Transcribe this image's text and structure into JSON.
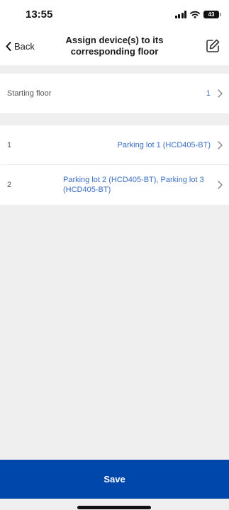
{
  "status_bar": {
    "time": "13:55",
    "battery": "43"
  },
  "nav": {
    "back_label": "Back",
    "title": "Assign device(s) to its corresponding floor",
    "icons": {
      "back": "chevron-left-icon",
      "edit": "edit-icon"
    }
  },
  "starting_floor": {
    "label": "Starting floor",
    "value": "1"
  },
  "floors": [
    {
      "number": "1",
      "devices": "Parking lot 1 (HCD405-BT)"
    },
    {
      "number": "2",
      "devices": "Parking lot 2 (HCD405-BT), Parking lot 3 (HCD405-BT)"
    }
  ],
  "footer": {
    "save_label": "Save"
  },
  "colors": {
    "accent": "#0047ab",
    "link": "#3b6fc4",
    "background": "#efefef"
  }
}
